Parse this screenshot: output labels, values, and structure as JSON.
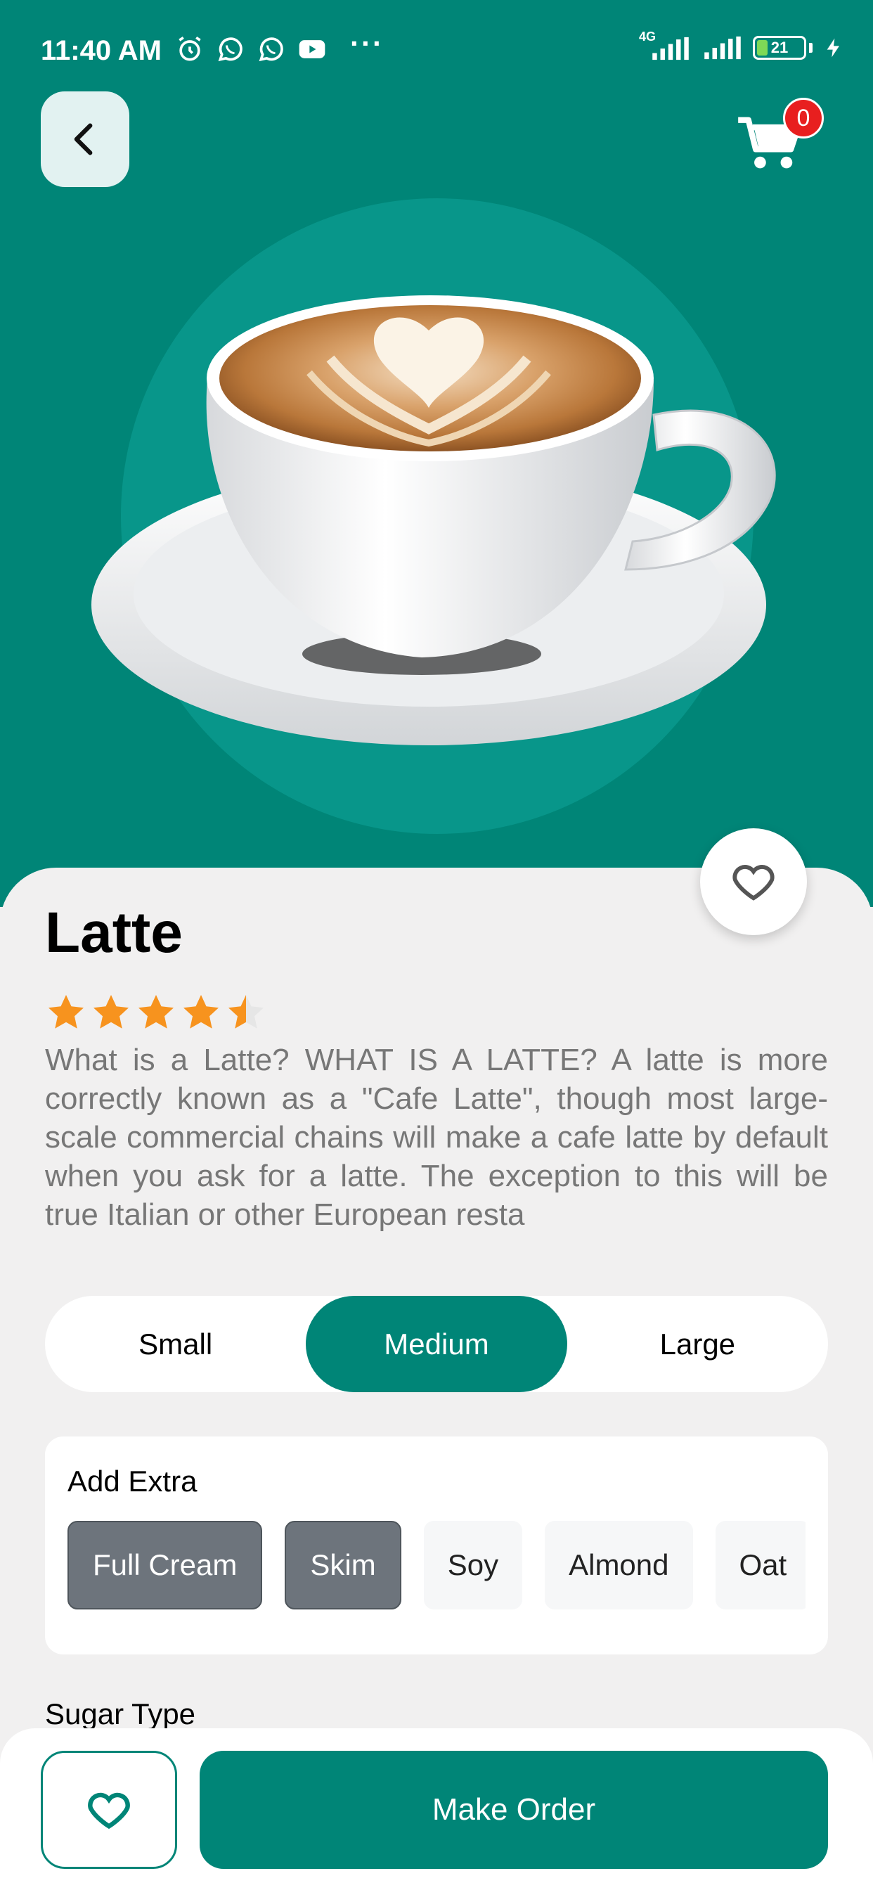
{
  "status_bar": {
    "time": "11:40 AM",
    "more": "···",
    "network": "4G",
    "battery": "21"
  },
  "header": {
    "back_icon": "chevron-left-icon",
    "cart_icon": "shopping-cart-icon",
    "cart_count": "0"
  },
  "colors": {
    "primary": "#008577",
    "hero_circle": "#08968a",
    "star": "#f7931e",
    "badge": "#e81f1f",
    "selected_chip": "#6d747c"
  },
  "product": {
    "image": "latte-cup",
    "name": "Latte",
    "rating": 4.5,
    "rating_max": 5,
    "description": "What is a Latte? WHAT IS A LATTE? A latte is more correctly known as a \"Cafe Latte\", though most large-scale commercial chains will make a cafe latte by default when you ask for a latte. The exception to this will be true Italian or other European resta"
  },
  "sizes": {
    "options": [
      "Small",
      "Medium",
      "Large"
    ],
    "selected": "Medium"
  },
  "extras": {
    "title": "Add Extra",
    "options": [
      "Full Cream",
      "Skim",
      "Soy",
      "Almond",
      "Oat"
    ],
    "selected": [
      "Full Cream",
      "Skim"
    ]
  },
  "sugar": {
    "label": "Sugar Type"
  },
  "footer": {
    "favorite_icon": "heart-icon",
    "order_label": "Make Order"
  }
}
